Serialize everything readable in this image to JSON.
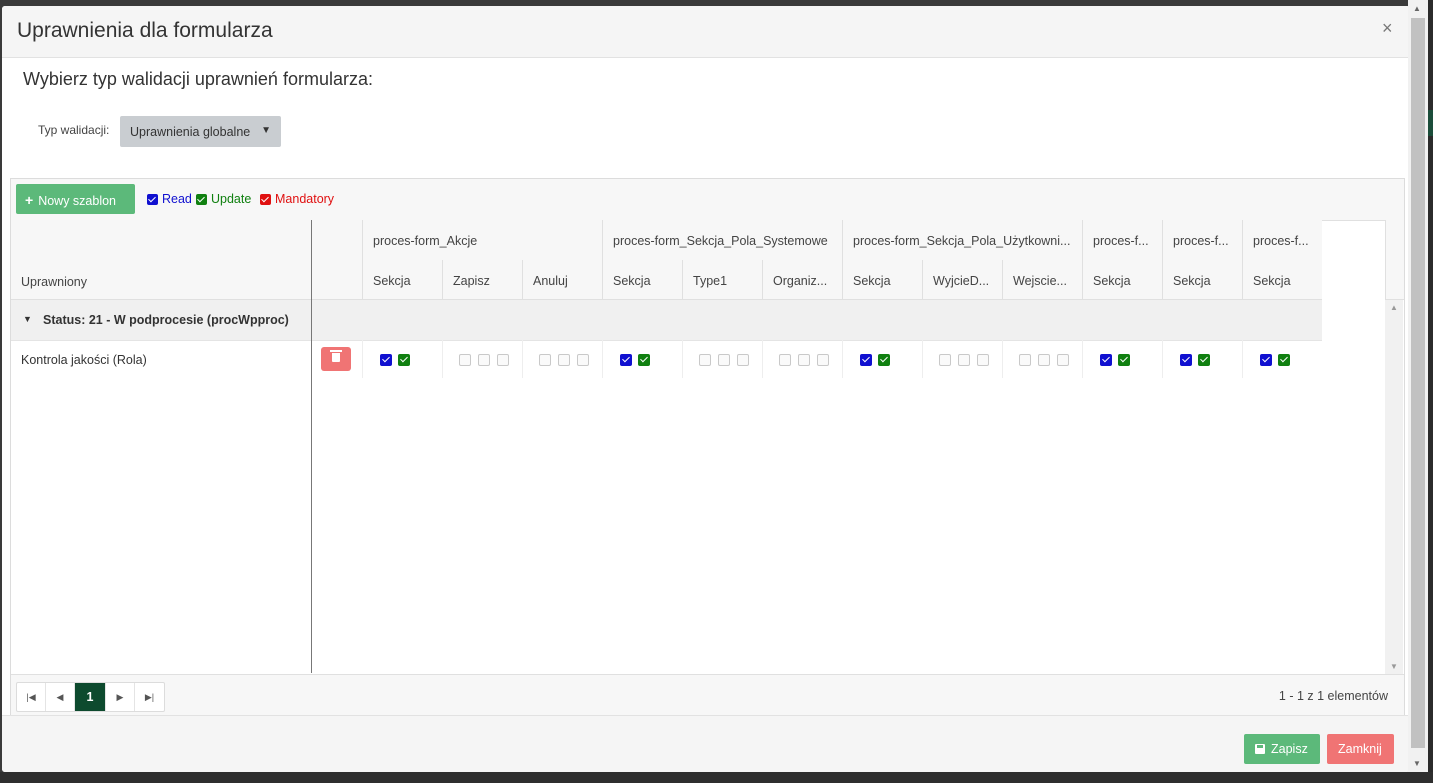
{
  "modal": {
    "title": "Uprawnienia dla formularza",
    "close_glyph": "×",
    "subtitle": "Wybierz typ walidacji uprawnień formularza:"
  },
  "validation": {
    "label": "Typ walidacji:",
    "selected": "Uprawnienia globalne"
  },
  "toolbar": {
    "new_template": "Nowy szablon",
    "legend": [
      {
        "label": "Read",
        "color": "#1010d0"
      },
      {
        "label": "Update",
        "color": "#108010"
      },
      {
        "label": "Mandatory",
        "color": "#e01010"
      }
    ]
  },
  "grid": {
    "locked_header": "Uprawniony",
    "group_label": "Status: 21 - W podprocesie (procWpproc)",
    "row_name": "Kontrola jakości (Rola)",
    "column_groups": [
      {
        "label": "proces-form_Akcje",
        "columns": [
          "Sekcja",
          "Zapisz",
          "Anuluj"
        ]
      },
      {
        "label": "proces-form_Sekcja_Pola_Systemowe",
        "columns": [
          "Sekcja",
          "Type1",
          "Organiz..."
        ]
      },
      {
        "label": "proces-form_Sekcja_Pola_Użytkowni...",
        "columns": [
          "Sekcja",
          "WyjcieD...",
          "Wejscie..."
        ]
      },
      {
        "label": "proces-f...",
        "columns": [
          "Sekcja"
        ]
      },
      {
        "label": "proces-f...",
        "columns": [
          "Sekcja"
        ]
      },
      {
        "label": "proces-f...",
        "columns": [
          "Sekcja"
        ]
      }
    ],
    "row_permissions": [
      {
        "read": true,
        "update": true
      },
      {
        "read": false,
        "update": false,
        "mandatory": false
      },
      {
        "read": false,
        "update": false,
        "mandatory": false
      },
      {
        "read": true,
        "update": true
      },
      {
        "read": false,
        "update": false,
        "mandatory": false
      },
      {
        "read": false,
        "update": false,
        "mandatory": false
      },
      {
        "read": true,
        "update": true
      },
      {
        "read": false,
        "update": false,
        "mandatory": false
      },
      {
        "read": false,
        "update": false,
        "mandatory": false
      },
      {
        "read": true,
        "update": true
      },
      {
        "read": true,
        "update": true
      },
      {
        "read": true,
        "update": true
      }
    ]
  },
  "pager": {
    "current_page": "1",
    "info": "1 - 1 z 1 elementów"
  },
  "footer": {
    "save_label": "Zapisz",
    "close_label": "Zamknij"
  },
  "icons": [
    "plus-icon",
    "trash-icon",
    "save-icon",
    "close-icon",
    "first-page-icon",
    "prev-page-icon",
    "next-page-icon",
    "last-page-icon",
    "caret-down-icon",
    "expand-triangle-icon"
  ]
}
